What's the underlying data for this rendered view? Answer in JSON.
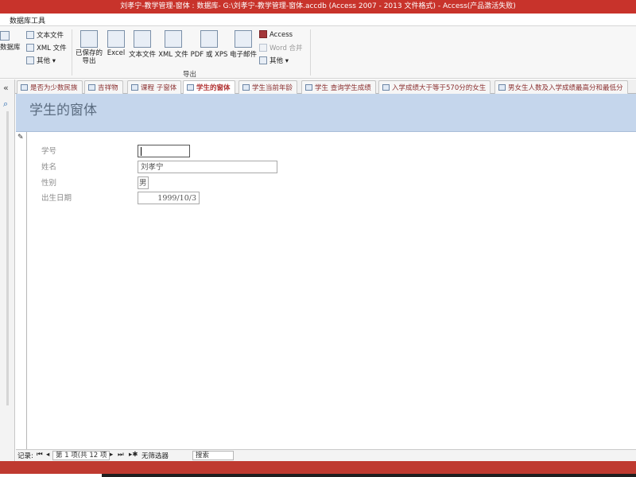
{
  "window": {
    "title": "刘孝宁-教学管理-窗体 : 数据库- G:\\刘孝宁-教学管理-窗体.accdb (Access 2007 - 2013 文件格式) -  Access(产品激活失败)"
  },
  "ribbon": {
    "context_tab": "数据库工具",
    "import_group": {
      "database_label": "数据库",
      "text_file": "文本文件",
      "xml_file": "XML 文件",
      "more": "其他 ▾"
    },
    "export_group": {
      "saved_exports": "已保存的\n导出",
      "excel": "Excel",
      "text_file": "文本文件",
      "xml_file": "XML 文件",
      "pdf_xps": "PDF 或 XPS",
      "email": "电子邮件",
      "access": "Access",
      "word_merge": "Word 合并",
      "more": "其他 ▾",
      "group_label": "导出"
    }
  },
  "nav_pane": {
    "collapse_glyph": "«",
    "search_glyph": "⌕"
  },
  "document_tabs": [
    {
      "label": "是否为少数民族",
      "active": false
    },
    {
      "label": "吉祥物",
      "active": false
    },
    {
      "label": "课程 子窗体",
      "active": false
    },
    {
      "label": "学生的窗体",
      "active": true
    },
    {
      "label": "学生当前年龄",
      "active": false
    },
    {
      "label": "学生 查询学生成绩",
      "active": false
    },
    {
      "label": "入学成绩大于等于570分的女生",
      "active": false
    },
    {
      "label": "男女生人数及入学成绩最高分和最低分",
      "active": false
    }
  ],
  "form": {
    "title": "学生的窗体",
    "fields": [
      {
        "label": "学号",
        "value": ""
      },
      {
        "label": "姓名",
        "value": "刘孝宁"
      },
      {
        "label": "性别",
        "value": "男"
      },
      {
        "label": "出生日期",
        "value": "1999/10/3"
      }
    ]
  },
  "record_nav": {
    "label": "记录:",
    "first": "⏮",
    "prev": "◂",
    "position": "第 1 项(共 12 项",
    "next": "▸",
    "last": "⏭",
    "new": "▸✱",
    "filter": "无筛选器",
    "search_label": "搜索"
  }
}
